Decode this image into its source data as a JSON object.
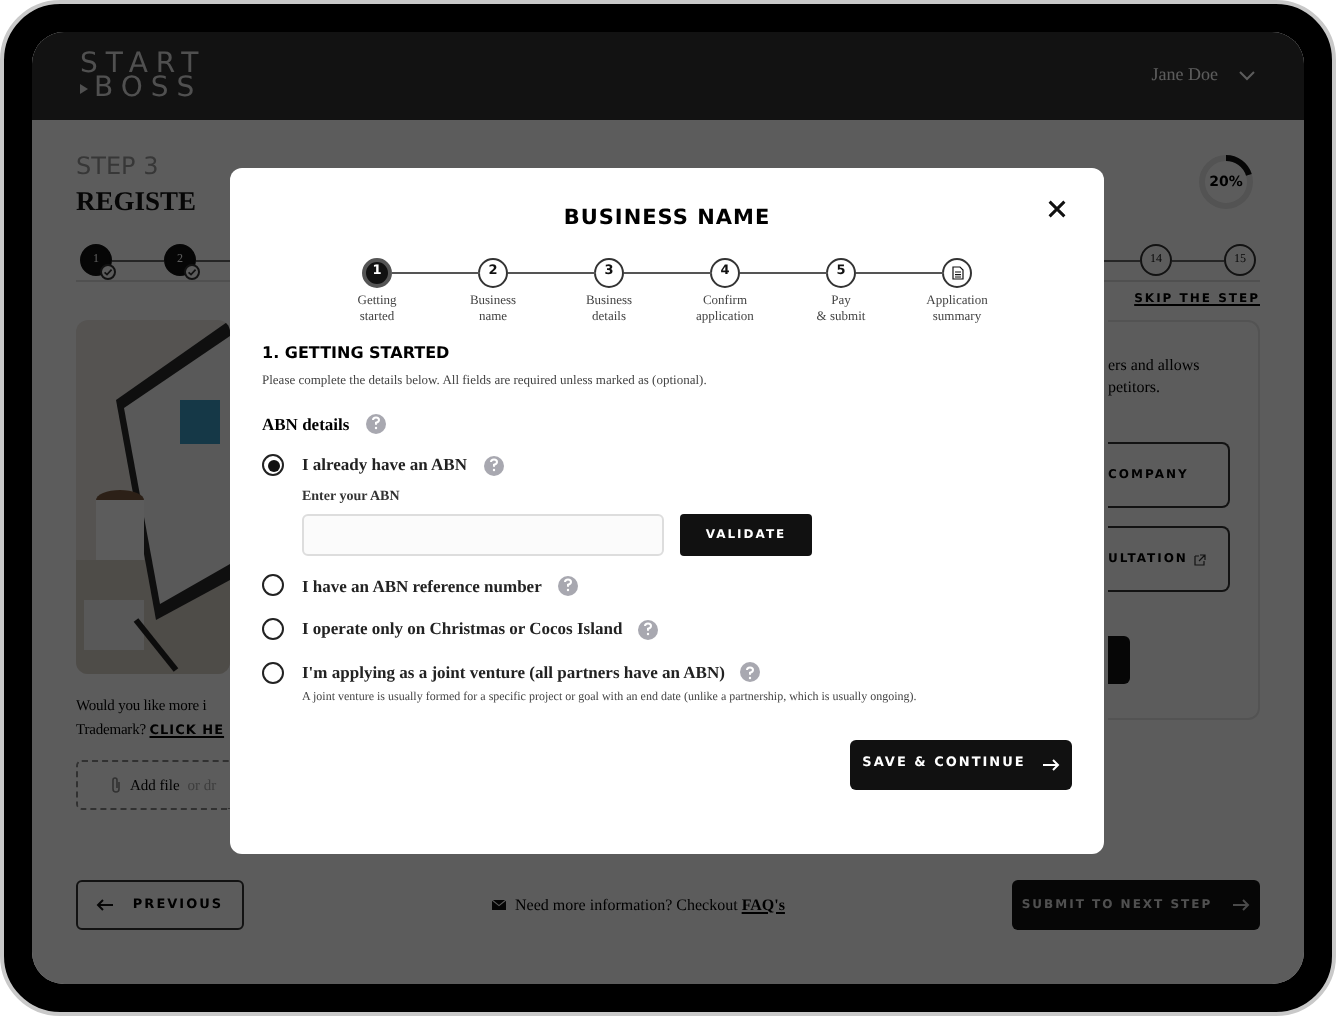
{
  "header": {
    "logo_lines": [
      "START",
      "BOSS"
    ],
    "user": "Jane Doe"
  },
  "page": {
    "step_label": "STEP 3",
    "title": "REGISTE",
    "progress": {
      "text": "20%",
      "level": 0.2
    },
    "steps": [
      {
        "label": "1",
        "completed": true
      },
      {
        "label": "2",
        "completed": true
      },
      {
        "label": "14",
        "completed": false
      },
      {
        "label": "15",
        "completed": false
      }
    ],
    "skip_link": "SKIP THE STEP",
    "left_card": {
      "text_lines": [
        "Would you like more i",
        "Trademark?"
      ],
      "link": "CLICK HE",
      "upload": {
        "label": "Add file",
        "hint": "or dr"
      }
    },
    "right_card": {
      "text_lines": [
        "ers and allows",
        "petitors."
      ],
      "buttons": [
        {
          "label": "COMPANY",
          "external": false
        },
        {
          "label": "ULTATION",
          "external": true
        }
      ]
    },
    "footer": {
      "previous": "PREVIOUS",
      "info": "Need more information? Checkout",
      "info_link": "FAQ's",
      "submit": "SUBMIT TO NEXT STEP"
    }
  },
  "modal": {
    "title": "BUSINESS NAME",
    "steps": [
      {
        "kind": "number",
        "number": "1",
        "label": "Getting\nstarted",
        "selected": true
      },
      {
        "kind": "number",
        "number": "2",
        "label": "Business\nname",
        "selected": false
      },
      {
        "kind": "number",
        "number": "3",
        "label": "Business\ndetails",
        "selected": false
      },
      {
        "kind": "number",
        "number": "4",
        "label": "Confirm\napplication",
        "selected": false
      },
      {
        "kind": "number",
        "number": "5",
        "label": "Pay\n& submit",
        "selected": false
      },
      {
        "kind": "document",
        "label": "Application\nsummary",
        "selected": false
      }
    ],
    "section_title": "1. GETTING STARTED",
    "intro": "Please complete the details below. All fields are required unless marked as (optional).",
    "group_label": "ABN details",
    "options": [
      {
        "label": "I already have an ABN",
        "selected": true,
        "field": {
          "label": "Enter your ABN",
          "button": "VALIDATE"
        }
      },
      {
        "label": "I have an ABN reference number",
        "selected": false
      },
      {
        "label": "I operate only on Christmas or Cocos Island",
        "selected": false
      },
      {
        "label": "I'm applying as a joint venture (all partners have an ABN)",
        "selected": false,
        "note": "A joint venture is usually formed for a specific project or goal with an end date (unlike a partnership, which is usually ongoing)."
      }
    ],
    "save_button": "SAVE & CONTINUE"
  }
}
